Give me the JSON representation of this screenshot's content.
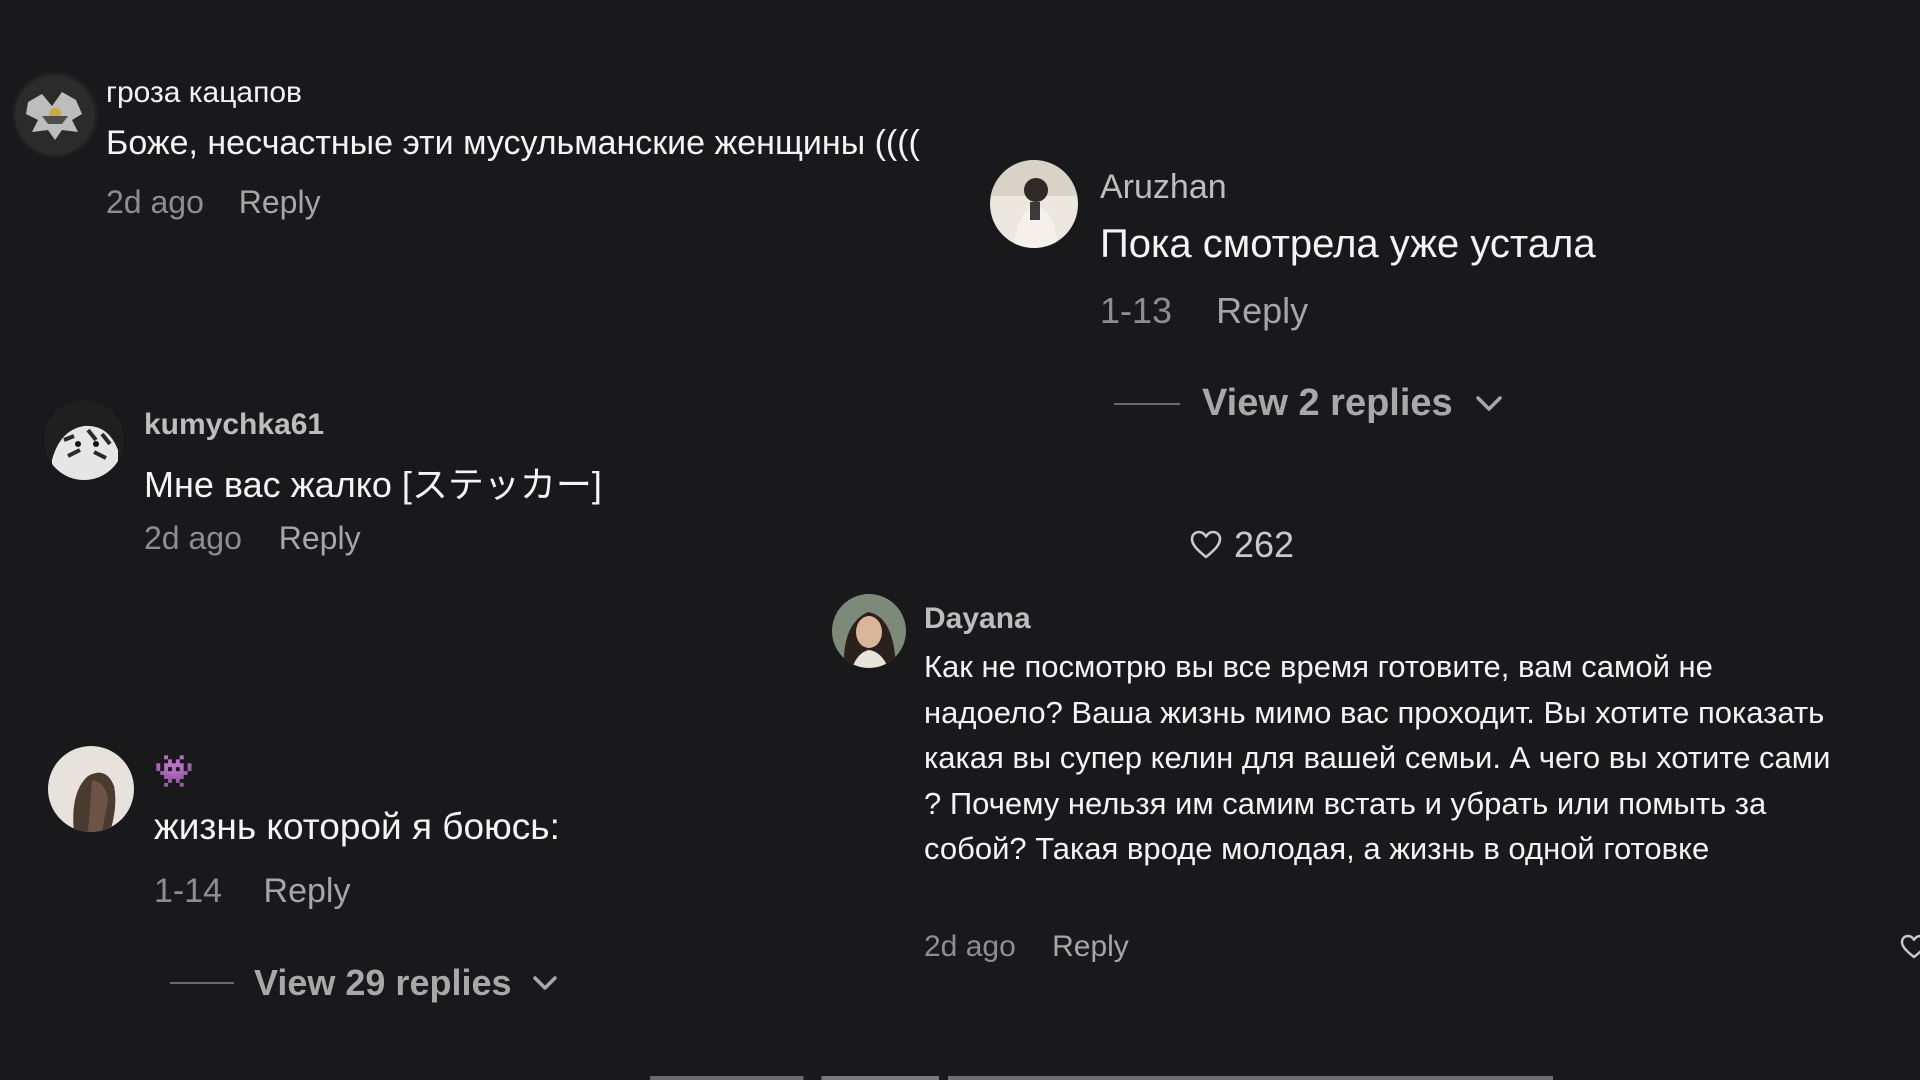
{
  "comments": [
    {
      "username": "гроза кацапов",
      "text": "Боже, несчастные эти мусульманские женщины ((((",
      "time": "2d ago",
      "reply_label": "Reply"
    },
    {
      "username": "kumychka61",
      "text": "Мне вас жалко [ステッカー]",
      "time": "2d ago",
      "reply_label": "Reply"
    },
    {
      "username": "👾",
      "text": "жизнь которой я боюсь:",
      "time": "1-14",
      "reply_label": "Reply",
      "view_replies_label": "View 29 replies"
    },
    {
      "username": "Aruzhan",
      "text": "Пока смотрела уже устала",
      "time": "1-13",
      "reply_label": "Reply",
      "view_replies_label": "View 2 replies",
      "likes": "262"
    },
    {
      "username": "Dayana",
      "text": "Как не посмотрю вы все время готовите, вам самой не надоело? Ваша жизнь мимо вас проходит. Вы хотите показать какая вы супер келин для вашей семьи. А чего вы хотите сами ? Почему нельзя им самим встать и убрать или помыть за собой? Такая вроде молодая, а жизнь в одной готовке",
      "time": "2d ago",
      "reply_label": "Reply"
    }
  ],
  "icons": {
    "like": "heart-outline-icon",
    "expand": "chevron-down-icon"
  },
  "colors": {
    "background": "#19191b",
    "text": "#f4f4f4",
    "muted": "#8e8e8e",
    "username": "#bdbdbd"
  }
}
